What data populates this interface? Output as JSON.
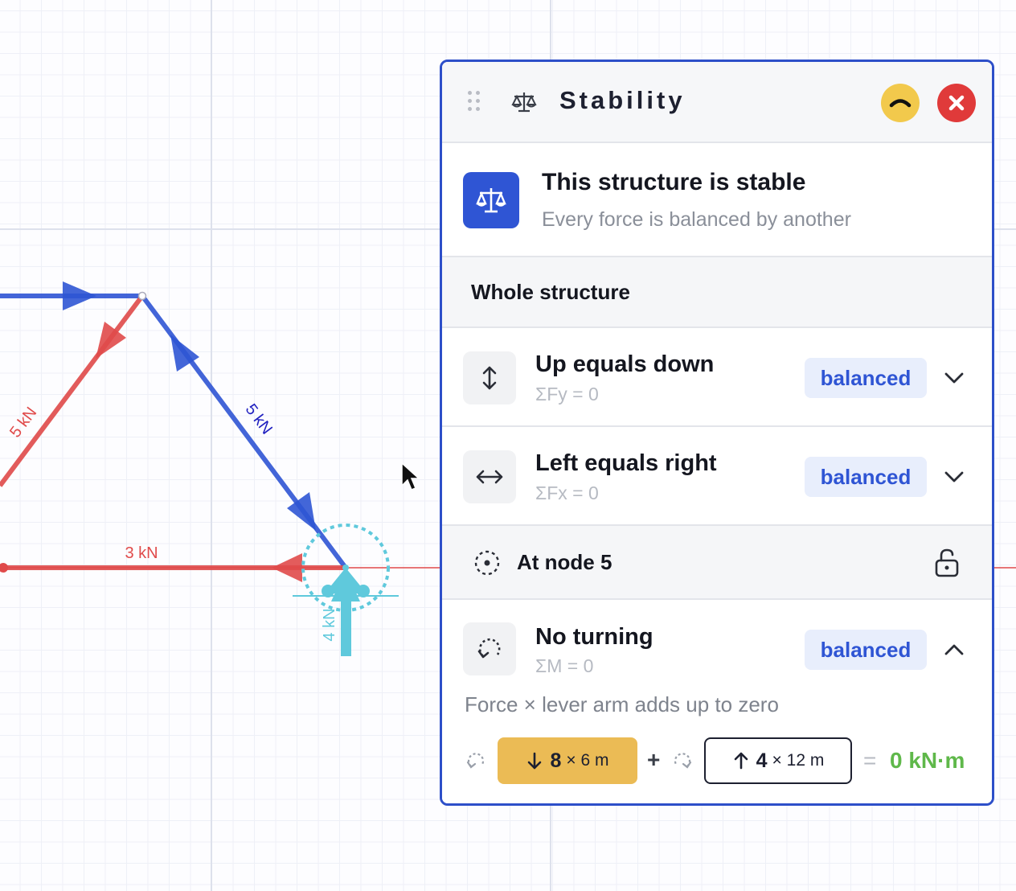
{
  "canvas": {
    "labels": {
      "red_diagonal": "5 kN",
      "blue_diagonal": "5 kN",
      "red_horizontal": "3 kN",
      "reaction": "4 kN"
    },
    "colors": {
      "red": "#e04a4a",
      "blue": "#2f55d4",
      "cyan": "#5fc9dc",
      "grid": "#eef0f7"
    }
  },
  "panel": {
    "title": "Stability",
    "collapse_icon": "chevron-up-icon",
    "close_icon": "close-icon",
    "status": {
      "title": "This structure is stable",
      "subtitle": "Every force is balanced by another",
      "icon": "balance-scale-icon"
    },
    "whole_structure": {
      "label": "Whole structure",
      "checks": [
        {
          "title": "Up equals down",
          "formula": "ΣFy = 0",
          "badge": "balanced",
          "icon": "vertical-arrows-icon",
          "expanded": false
        },
        {
          "title": "Left equals right",
          "formula": "ΣFx = 0",
          "badge": "balanced",
          "icon": "horizontal-arrows-icon",
          "expanded": false
        }
      ]
    },
    "node": {
      "label": "At node 5",
      "lock_icon": "unlock-icon",
      "check": {
        "title": "No turning",
        "formula": "ΣM = 0",
        "badge": "balanced",
        "icon": "rotation-icon",
        "expanded": true,
        "description": "Force × lever arm adds up to zero",
        "equation": {
          "term1": {
            "force": "8",
            "arm": "× 6 m",
            "direction": "down"
          },
          "plus": "+",
          "term2": {
            "force": "4",
            "arm": "× 12 m",
            "direction": "up"
          },
          "equals": "=",
          "result": "0 kN·m"
        }
      }
    },
    "accent_colors": {
      "primary": "#2f55d4",
      "collapse": "#f2c94c",
      "close": "#e03a3a",
      "result": "#5fb84a",
      "term1": "#ebbb55"
    }
  }
}
